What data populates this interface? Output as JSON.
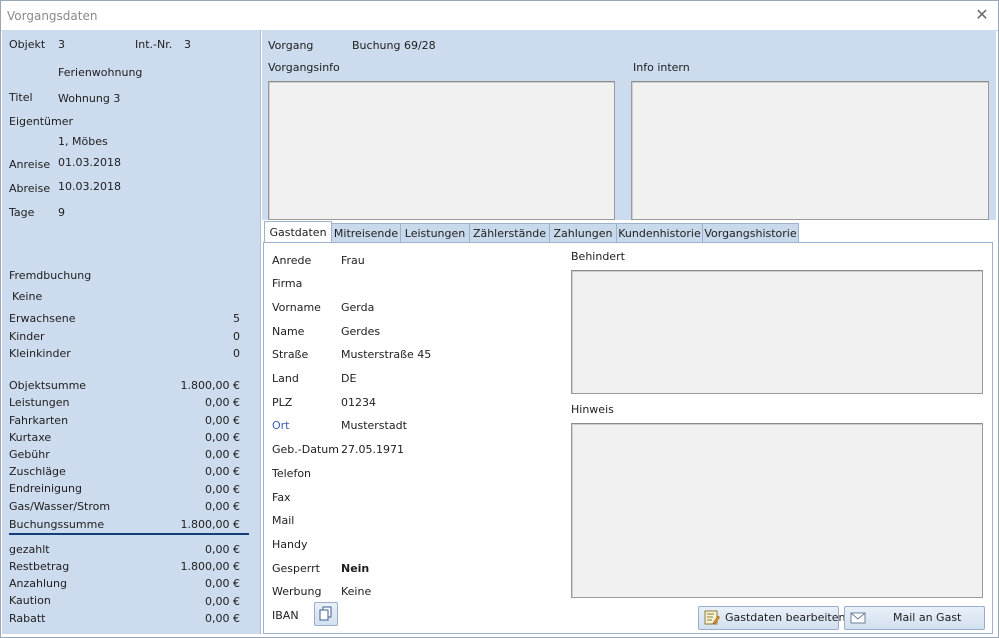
{
  "window": {
    "title": "Vorgangsdaten"
  },
  "left": {
    "objekt_label": "Objekt",
    "objekt_value": "3",
    "intnr_label": "Int.-Nr.",
    "intnr_value": "3",
    "objekt_name": "Ferienwohnung",
    "titel_label": "Titel",
    "titel_value": "Wohnung 3",
    "eigentuemer_label": "Eigentümer",
    "eigentuemer_value": "1, Möbes",
    "anreise_label": "Anreise",
    "anreise_value": "01.03.2018",
    "abreise_label": "Abreise",
    "abreise_value": "10.03.2018",
    "tage_label": "Tage",
    "tage_value": "9",
    "fremdbuchung_label": "Fremdbuchung",
    "fremdbuchung_value": "Keine",
    "persons": [
      {
        "label": "Erwachsene",
        "value": "5"
      },
      {
        "label": "Kinder",
        "value": "0"
      },
      {
        "label": "Kleinkinder",
        "value": "0"
      }
    ],
    "costs": [
      {
        "label": "Objektsumme",
        "value": "1.800,00 €"
      },
      {
        "label": "Leistungen",
        "value": "0,00 €"
      },
      {
        "label": "Fahrkarten",
        "value": "0,00 €"
      },
      {
        "label": "Kurtaxe",
        "value": "0,00 €"
      },
      {
        "label": "Gebühr",
        "value": "0,00 €"
      },
      {
        "label": "Zuschläge",
        "value": "0,00 €"
      },
      {
        "label": "Endreinigung",
        "value": "0,00 €"
      },
      {
        "label": "Gas/Wasser/Strom",
        "value": "0,00 €"
      },
      {
        "label": "Buchungssumme",
        "value": "1.800,00 €"
      }
    ],
    "payments": [
      {
        "label": "gezahlt",
        "value": "0,00 €"
      },
      {
        "label": "Restbetrag",
        "value": "1.800,00 €"
      },
      {
        "label": "Anzahlung",
        "value": "0,00 €"
      },
      {
        "label": "Kaution",
        "value": "0,00 €"
      },
      {
        "label": "Rabatt",
        "value": "0,00 €"
      }
    ]
  },
  "top": {
    "vorgang_label": "Vorgang",
    "vorgang_value": "Buchung 69/28",
    "vorgangsinfo_label": "Vorgangsinfo",
    "info_intern_label": "Info intern"
  },
  "tabs": [
    "Gastdaten",
    "Mitreisende",
    "Leistungen",
    "Zählerstände",
    "Zahlungen",
    "Kundenhistorie",
    "Vorgangshistorie"
  ],
  "guest": {
    "fields": [
      {
        "label": "Anrede",
        "value": "Frau"
      },
      {
        "label": "Firma",
        "value": ""
      },
      {
        "label": "Vorname",
        "value": "Gerda"
      },
      {
        "label": "Name",
        "value": "Gerdes"
      },
      {
        "label": "Straße",
        "value": "Musterstraße 45"
      },
      {
        "label": "Land",
        "value": "DE"
      },
      {
        "label": "PLZ",
        "value": "01234"
      },
      {
        "label": "Ort",
        "value": "Musterstadt"
      },
      {
        "label": "Geb.-Datum",
        "value": "27.05.1971"
      },
      {
        "label": "Telefon",
        "value": ""
      },
      {
        "label": "Fax",
        "value": ""
      },
      {
        "label": "Mail",
        "value": ""
      },
      {
        "label": "Handy",
        "value": ""
      },
      {
        "label": "Gesperrt",
        "value": "Nein"
      },
      {
        "label": "Werbung",
        "value": "Keine"
      },
      {
        "label": "IBAN",
        "value": ""
      }
    ],
    "behindert_label": "Behindert",
    "hinweis_label": "Hinweis",
    "edit_button": "Gastdaten bearbeiten",
    "mail_button": "Mail an Gast"
  },
  "colors": {
    "left_panel": "#ccdbed",
    "separator": "#123e7a",
    "ort_link": "#3a5fb0"
  },
  "icons": {
    "close": "close-icon",
    "edit": "edit-form-icon",
    "mail": "envelope-icon",
    "copy": "copy-icon"
  }
}
